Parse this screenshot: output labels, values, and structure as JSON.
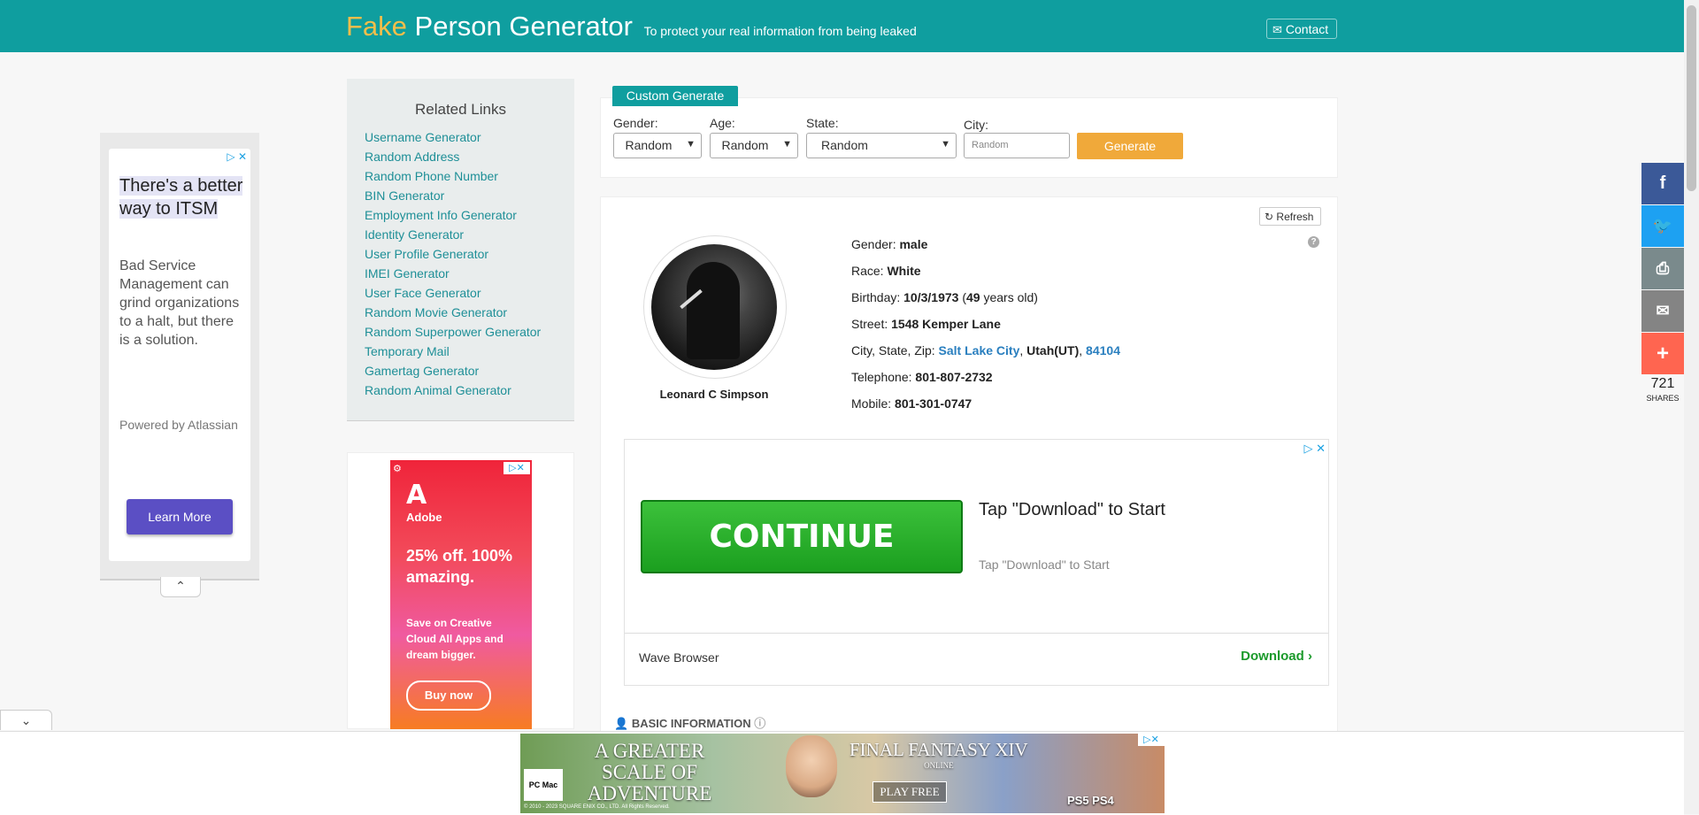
{
  "header": {
    "brand_fake": "Fake",
    "brand_rest": " Person Generator",
    "tagline": "To protect your real information from being leaked",
    "contact_label": "Contact"
  },
  "left_ad": {
    "headline": "There's a better way to ITSM",
    "body": "Bad Service Management can grind organizations to a halt, but there is a solution.",
    "powered": "Powered by Atlassian",
    "cta": "Learn More"
  },
  "related": {
    "title": "Related Links",
    "links": [
      "Username Generator",
      "Random Address",
      "Random Phone Number",
      "BIN Generator",
      "Employment Info Generator",
      "Identity Generator",
      "User Profile Generator",
      "IMEI Generator",
      "User Face Generator",
      "Random Movie Generator",
      "Random Superpower Generator",
      "Temporary Mail",
      "Gamertag Generator",
      "Random Animal Generator"
    ]
  },
  "adobe_ad": {
    "logo_mark": "A",
    "brand": "Adobe",
    "headline": "25% off. 100% amazing.",
    "sub": "Save on Creative Cloud All Apps and dream bigger.",
    "cta": "Buy now"
  },
  "custom": {
    "tab": "Custom Generate",
    "gender_label": "Gender:",
    "gender_value": "Random",
    "age_label": "Age:",
    "age_value": "Random",
    "state_label": "State:",
    "state_value": "Random",
    "city_label": "City:",
    "city_placeholder": "Random",
    "generate": "Generate"
  },
  "person": {
    "refresh": "Refresh",
    "name": "Leonard C Simpson",
    "gender_label": "Gender: ",
    "gender": "male",
    "race_label": "Race: ",
    "race": "White",
    "birthday_label": "Birthday: ",
    "birthday": "10/3/1973",
    "age": "49",
    "age_suffix": " years old)",
    "street_label": "Street: ",
    "street": "1548 Kemper Lane",
    "csz_label": "City, State, Zip: ",
    "city": "Salt Lake City",
    "state": "Utah(UT)",
    "zip": "84104",
    "tel_label": "Telephone: ",
    "telephone": "801-807-2732",
    "mob_label": "Mobile: ",
    "mobile": "801-301-0747"
  },
  "wave_ad": {
    "button": "CONTINUE",
    "title": "Tap \"Download\" to Start",
    "subtitle": "Tap \"Download\" to Start",
    "brand": "Wave Browser",
    "download": "Download"
  },
  "section": {
    "basic": "BASIC INFORMATION"
  },
  "share": {
    "count": "721",
    "label": "SHARES",
    "colors": {
      "facebook": "#3b5998",
      "twitter": "#1da1f2",
      "print": "#7a8a8c",
      "email": "#848484",
      "more": "#ff6550"
    }
  },
  "ff_ad": {
    "headline": "A GREATER SCALE OF ADVENTURE",
    "logo": "FINAL FANTASY XIV",
    "logo_sub": "ONLINE",
    "cta": "PLAY FREE",
    "platforms": "PC  Mac",
    "ps": "PS5  PS4",
    "copyright": "© 2010 - 2023 SQUARE ENIX CO., LTD. All Rights Reserved."
  }
}
